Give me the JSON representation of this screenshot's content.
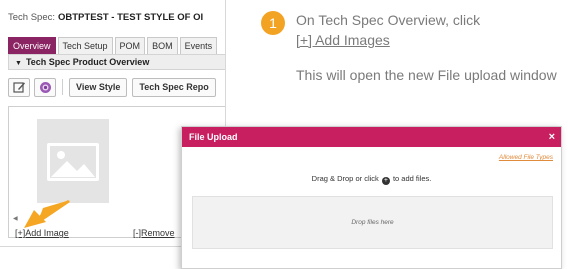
{
  "techspec": {
    "title_label": "Tech Spec:",
    "title_value": "OBTPTEST - TEST STYLE OF OI",
    "tabs": [
      {
        "label": "Overview",
        "active": true
      },
      {
        "label": "Tech Setup",
        "active": false
      },
      {
        "label": "POM",
        "active": false
      },
      {
        "label": "BOM",
        "active": false
      },
      {
        "label": "Events",
        "active": false
      }
    ],
    "section_title": "Tech Spec Product Overview",
    "toolbar": {
      "edit_icon": "edit-icon",
      "color_icon": "palette-icon",
      "view_style_label": "View Style",
      "tech_spec_report_label": "Tech Spec Repo"
    },
    "image_panel": {
      "add_image_label": "[+]Add Image",
      "remove_label": "[-]Remove"
    }
  },
  "callout": {
    "step_number": "1",
    "instruction_prefix": "On Tech Spec Overview,  click",
    "instruction_link": "[+] Add  Images",
    "instruction_result": "This will open the new File upload window"
  },
  "dialog": {
    "title": "File Upload",
    "close_label": "×",
    "allowed_types_label": "Allowed File Types",
    "drag_text_before": "Drag & Drop or click",
    "drag_text_after": "to add files.",
    "drop_zone_text": "Drop files here"
  },
  "colors": {
    "tab_active": "#8a2463",
    "dialog_header": "#c71f60",
    "step_badge": "#f2a324",
    "arrow": "#f5a623"
  }
}
